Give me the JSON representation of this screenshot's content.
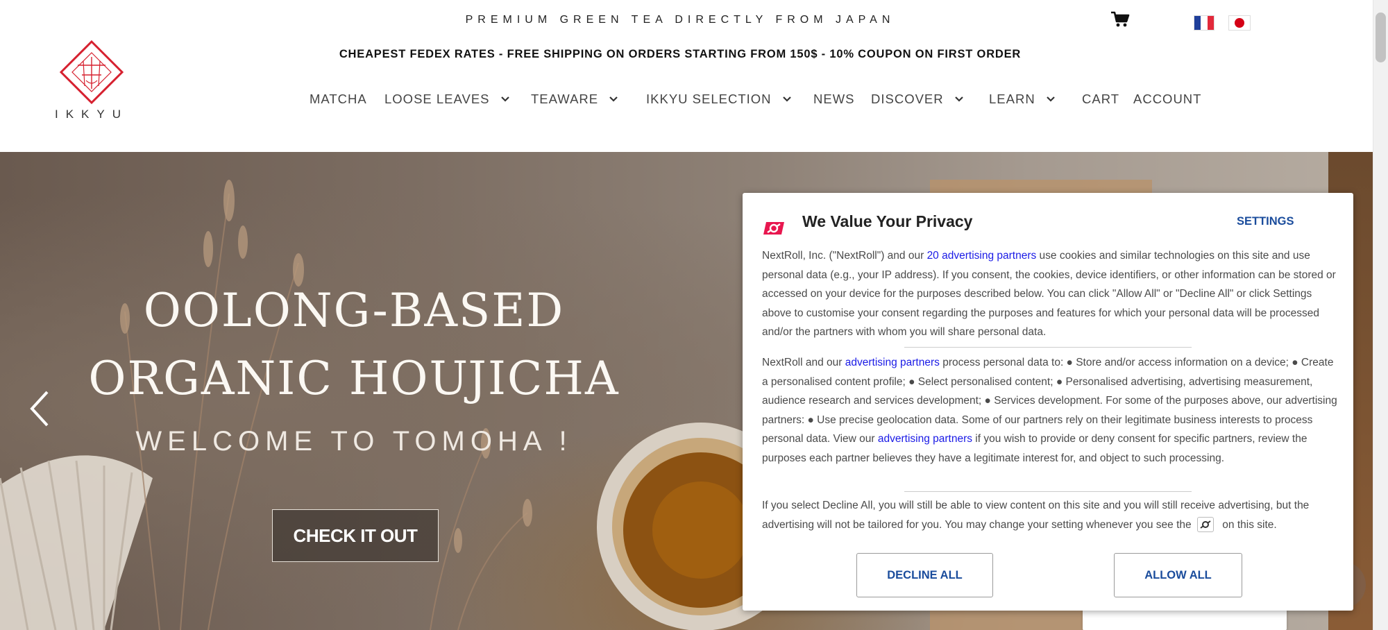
{
  "header": {
    "tagline": "PREMIUM GREEN TEA DIRECTLY FROM JAPAN",
    "shipping_banner": "CHEAPEST FEDEX RATES - FREE SHIPPING ON ORDERS STARTING FROM 150$ - 10% COUPON ON FIRST ORDER",
    "logo_text": "IKKYU",
    "icons": {
      "cart": "cart-icon",
      "lang_fr": "flag-fr-icon",
      "lang_jp": "flag-jp-icon"
    }
  },
  "nav": {
    "items": [
      {
        "label": "MATCHA",
        "dropdown": false
      },
      {
        "label": "LOOSE LEAVES",
        "dropdown": true
      },
      {
        "label": "TEAWARE",
        "dropdown": true
      },
      {
        "label": "IKKYU SELECTION",
        "dropdown": true
      },
      {
        "label": "NEWS",
        "dropdown": false
      },
      {
        "label": "DISCOVER",
        "dropdown": true
      },
      {
        "label": "LEARN",
        "dropdown": true
      },
      {
        "label": "CART",
        "dropdown": false
      },
      {
        "label": "ACCOUNT",
        "dropdown": false
      }
    ]
  },
  "hero": {
    "title_line1": "OOLONG-BASED",
    "title_line2": "ORGANIC HOUJICHA",
    "subtitle": "WELCOME TO TOMOHA !",
    "cta": "CHECK IT OUT",
    "prev_icon": "chevron-left-icon"
  },
  "privacy": {
    "title": "We Value Your Privacy",
    "settings": "SETTINGS",
    "p1_a": "NextRoll, Inc. (\"NextRoll\") and our ",
    "p1_link": "20 advertising partners",
    "p1_b": " use cookies and similar technologies on this site and use personal data (e.g., your IP address). If you consent, the cookies, device identifiers, or other information can be stored or accessed on your device for the purposes described below. You can click \"Allow All\" or \"Decline All\" or click Settings above to customise your consent regarding the purposes and features for which your personal data will be processed and/or the partners with whom you will share personal data.",
    "p2_a": "NextRoll and our ",
    "p2_link1": "advertising partners",
    "p2_b": " process personal data to: ● Store and/or access information on a device; ● Create a personalised content profile; ● Select personalised content; ● Personalised advertising, advertising measurement, audience research and services development; ● Services development. For some of the purposes above, our advertising partners: ● Use precise geolocation data. Some of our partners rely on their legitimate business interests to process personal data. View our ",
    "p2_link2": "advertising partners",
    "p2_c": " if you wish to provide or deny consent for specific partners, review the purposes each partner believes they have a legitimate interest for, and object to such processing.",
    "p3_a": "If you select Decline All, you will still be able to view content on this site and you will still receive advertising, but the advertising will not be tailored for you. You may change your setting whenever you see the ",
    "p3_b": " on this site.",
    "decline": "DECLINE ALL",
    "allow": "ALLOW ALL"
  },
  "colors": {
    "brand_red": "#d6202f",
    "link_blue": "#1a1ae6",
    "button_blue": "#1a4c9c",
    "nextroll_pink": "#e8174f"
  }
}
